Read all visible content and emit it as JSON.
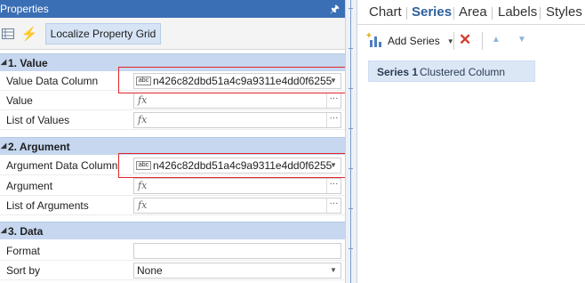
{
  "properties": {
    "title": "Properties",
    "toolbar": {
      "localize_label": "Localize Property Grid"
    },
    "categories": [
      {
        "label": "1. Value",
        "rows": [
          {
            "name": "Value Data Column",
            "value": "n426c82dbd51a4c9a9311e4dd0f6255"
          },
          {
            "name": "Value"
          },
          {
            "name": "List of Values"
          }
        ]
      },
      {
        "label": "2. Argument",
        "rows": [
          {
            "name": "Argument Data Column",
            "value": "n426c82dbd51a4c9a9311e4dd0f6255"
          },
          {
            "name": "Argument"
          },
          {
            "name": "List of Arguments"
          }
        ]
      },
      {
        "label": "3. Data",
        "rows": [
          {
            "name": "Format",
            "value": ""
          },
          {
            "name": "Sort by",
            "value": "None"
          }
        ]
      }
    ],
    "column_type_icon": "abc",
    "expression_icon": "fx",
    "ellipsis": "···"
  },
  "designer": {
    "tabs": [
      "Chart",
      "Series",
      "Area",
      "Labels",
      "Styles"
    ],
    "active_tab": "Series",
    "toolbar": {
      "add_series_label": "Add Series"
    },
    "series": [
      {
        "name": "Series 1",
        "type": "Clustered Column"
      }
    ]
  },
  "colors": {
    "header_blue": "#3b6fb5",
    "category_bg": "#c6d7ef",
    "highlight_red": "#e0262b",
    "active_tab": "#2d5f9e",
    "selected_series_bg": "#dce7f5"
  }
}
